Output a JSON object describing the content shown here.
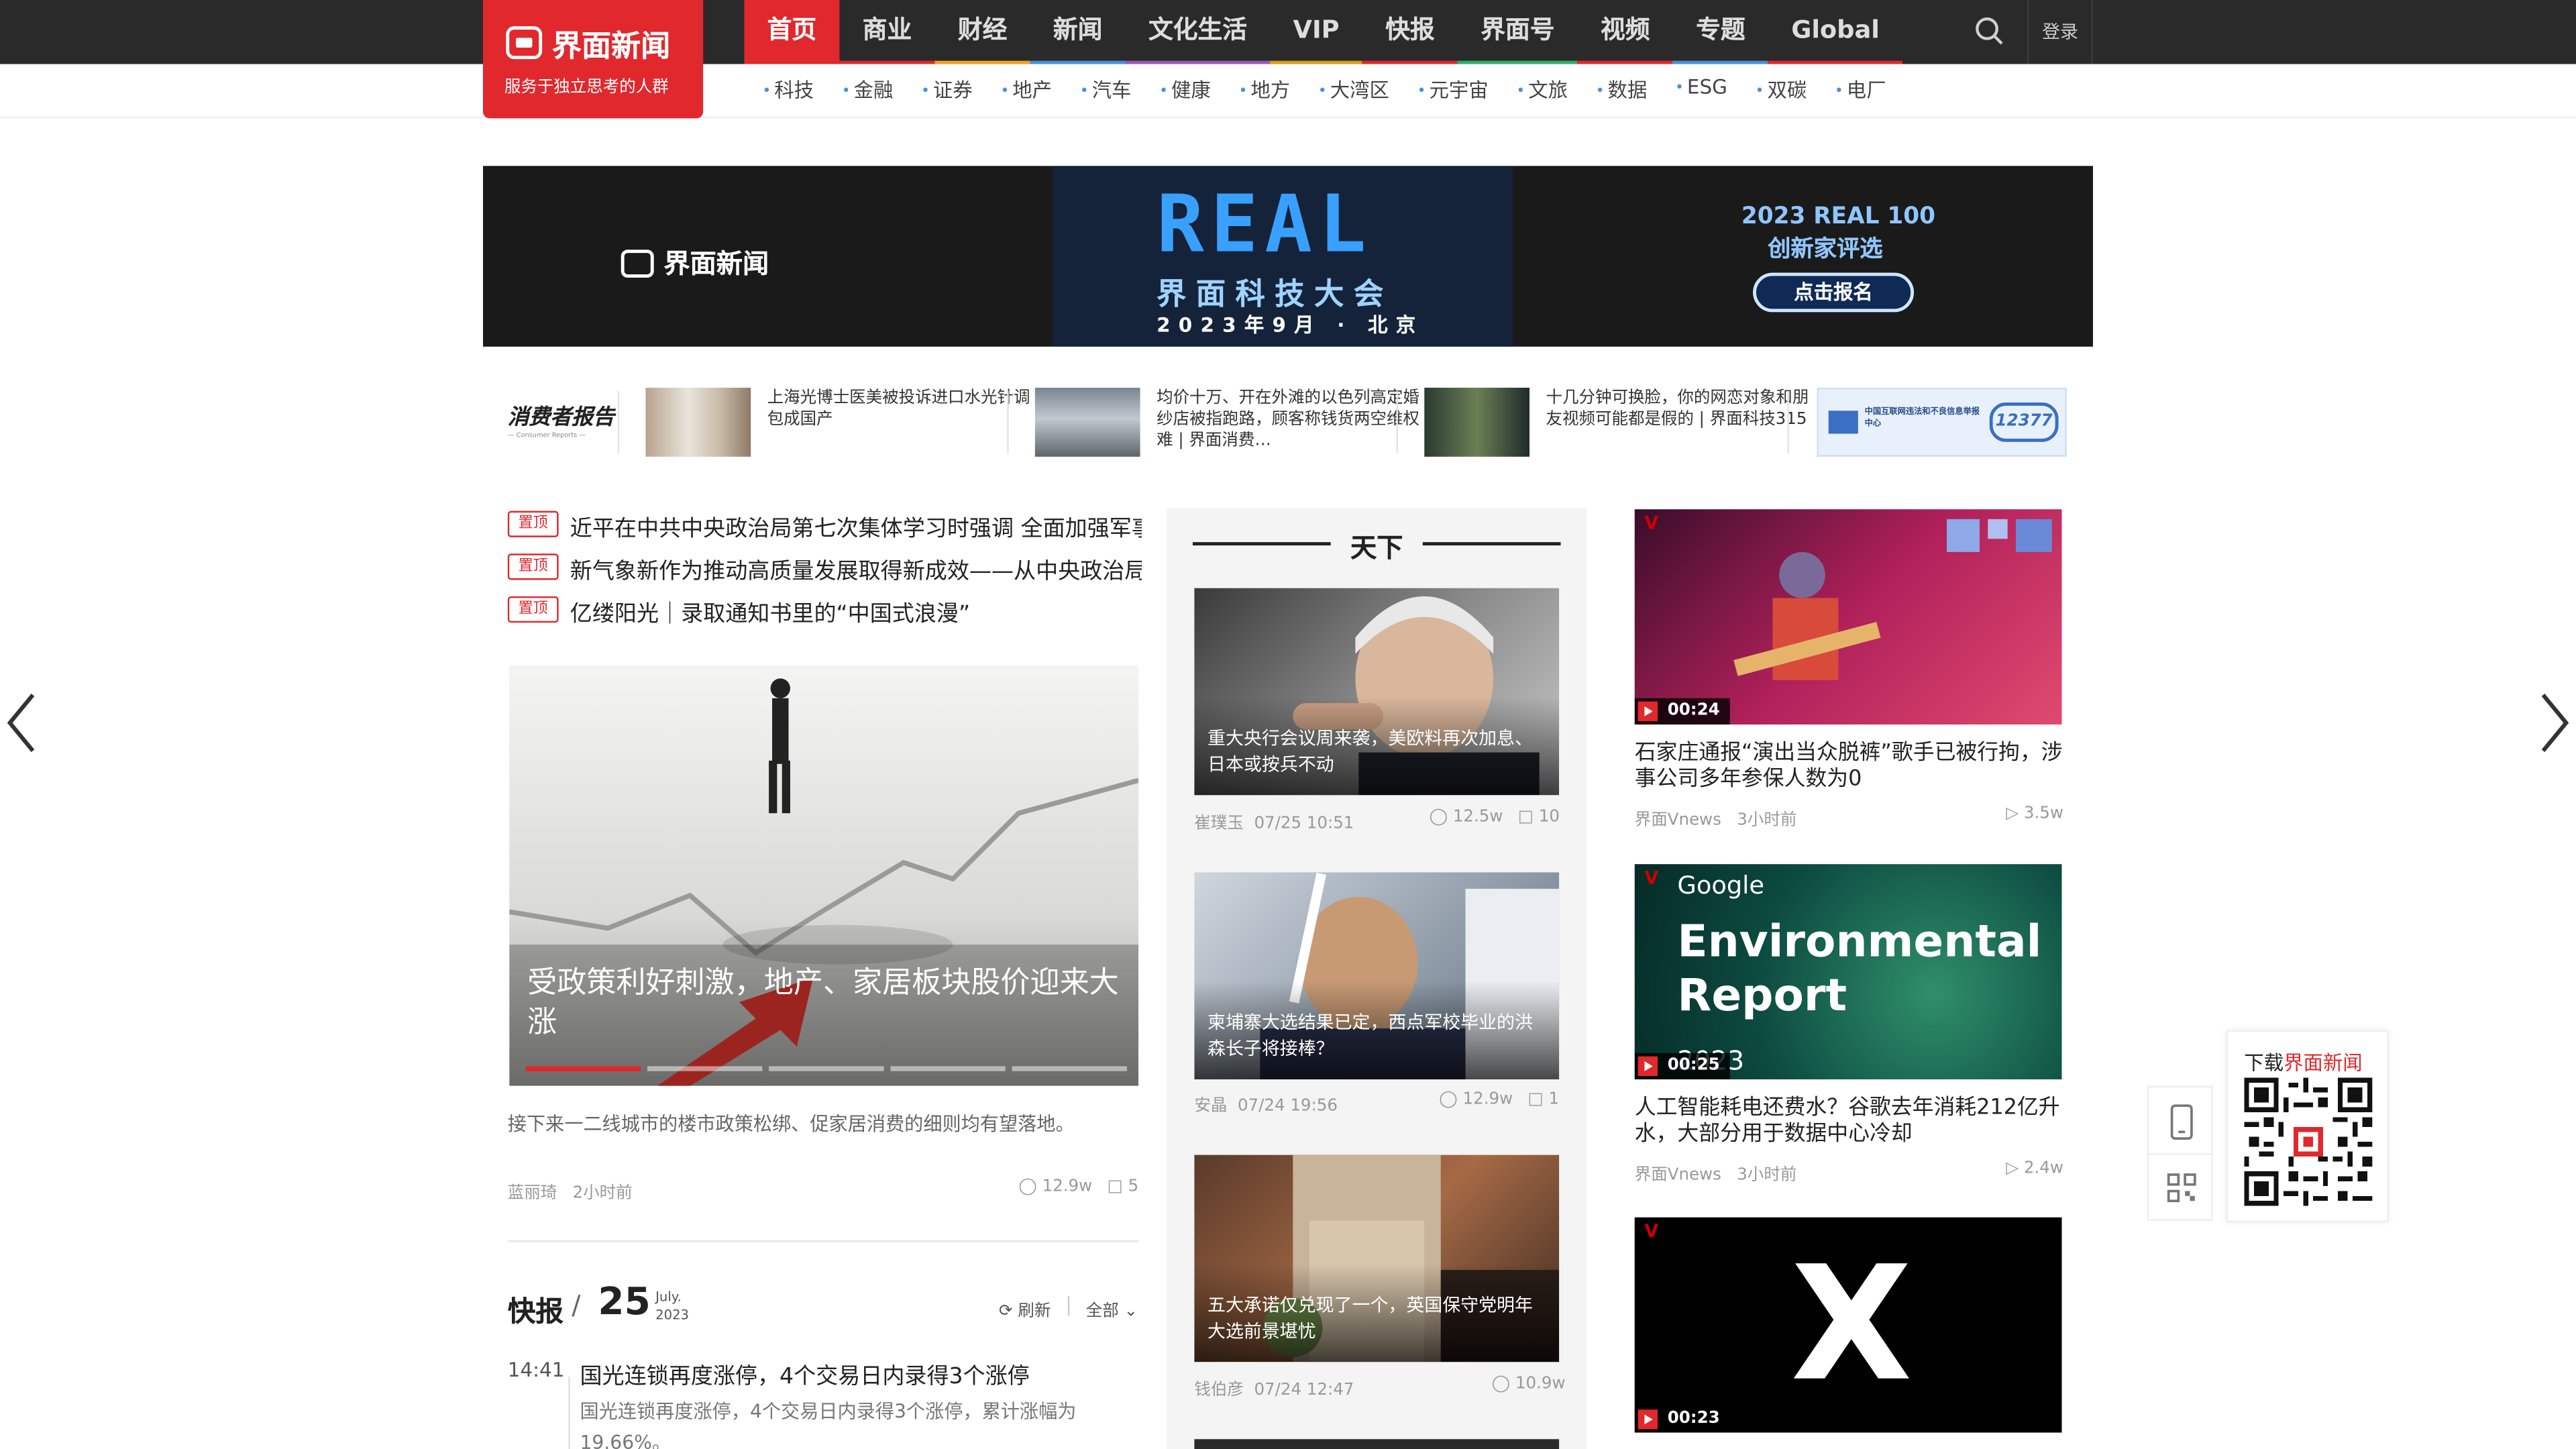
{
  "brand": {
    "name": "界面新闻",
    "slogan": "服务于独立思考的人群"
  },
  "nav": {
    "items": [
      {
        "label": "首页",
        "accent": "#e0282d"
      },
      {
        "label": "商业",
        "accent": "#e0282d"
      },
      {
        "label": "财经",
        "accent": "#f0a020"
      },
      {
        "label": "新闻",
        "accent": "#4a90d9"
      },
      {
        "label": "文化生活",
        "accent": "#9b59b6"
      },
      {
        "label": "VIP",
        "accent": "#d4a017"
      },
      {
        "label": "快报",
        "accent": "#e0282d"
      },
      {
        "label": "界面号",
        "accent": "#2eaf6a"
      },
      {
        "label": "视频",
        "accent": "#e0282d"
      },
      {
        "label": "专题",
        "accent": "#4a90d9"
      },
      {
        "label": "Global",
        "accent": "#e0282d"
      }
    ],
    "login": "登录"
  },
  "subnav": [
    "科技",
    "金融",
    "证券",
    "地产",
    "汽车",
    "健康",
    "地方",
    "大湾区",
    "元宇宙",
    "文旅",
    "数据",
    "ESG",
    "双碳",
    "电厂"
  ],
  "banner": {
    "logo": "界面新闻",
    "headline": "REAL",
    "conference": "界面科技大会",
    "date": "2023年9月 · 北京",
    "right_line1": "2023 REAL 100",
    "right_line2": "创新家评选",
    "button": "点击报名"
  },
  "promo": {
    "label": "消费者报告",
    "label_sub": "— Consumer Reports —",
    "items": [
      "上海光博士医美被投诉进口水光针调包成国产",
      "均价十万、开在外滩的以色列高定婚纱店被指跑路，顾客称钱货两空维权难 | 界面消费…",
      "十几分钟可换脸，你的网恋对象和朋友视频可能都是假的 | 界面科技315"
    ],
    "ad_left": "中国互联网违法和不良信息举报中心",
    "ad_right": "12377"
  },
  "pinned": {
    "badge": "置顶",
    "items": [
      "近平在中共中央政治局第七次集体学习时强调 全面加强军事治",
      "新气象新作为推动高质量发展取得新成效——从中央政治局会",
      "亿缕阳光｜录取通知书里的“中国式浪漫”"
    ]
  },
  "hero": {
    "caption": "受政策利好刺激，地产、家居板块股价迎来大涨",
    "desc": "接下来一二线城市的楼市政策松绑、促家居消费的细则均有望落地。",
    "author": "蓝丽琦",
    "time": "2小时前",
    "views": "12.9w",
    "comments": "5"
  },
  "flash": {
    "title": "快报",
    "day": "25",
    "month": "July.",
    "year": "2023",
    "refresh": "刷新",
    "filter": "全部",
    "item_time": "14:41",
    "item_head": "国光连锁再度涨停，4个交易日内录得3个涨停",
    "item_body": "国光连锁再度涨停，4个交易日内录得3个涨停，累计涨幅为19.66%。"
  },
  "world": {
    "title": "天下",
    "items": [
      {
        "caption": "重大央行会议周来袭，美欧料再次加息、日本或按兵不动",
        "author": "崔璞玉",
        "time": "07/25 10:51",
        "views": "12.5w",
        "comments": "10"
      },
      {
        "caption": "柬埔寨大选结果已定，西点军校毕业的洪森长子将接棒？",
        "author": "安晶",
        "time": "07/24 19:56",
        "views": "12.9w",
        "comments": "1"
      },
      {
        "caption": "五大承诺仅兑现了一个，英国保守党明年大选前景堪忧",
        "author": "钱伯彦",
        "time": "07/24 12:47",
        "views": "10.9w",
        "comments": ""
      }
    ]
  },
  "videos": {
    "items": [
      {
        "duration": "00:24",
        "title": "石家庄通报“演出当众脱裤”歌手已被行拘，涉事公司多年参保人数为0",
        "source": "界面Vnews",
        "time": "3小时前",
        "views": "3.5w"
      },
      {
        "duration": "00:25",
        "title": "人工智能耗电还费水？谷歌去年消耗212亿升水，大部分用于数据中心冷却",
        "source": "界面Vnews",
        "time": "3小时前",
        "views": "2.4w",
        "poster_line1": "Google",
        "poster_line2": "Environmental",
        "poster_line3": "Report",
        "poster_year": "2023"
      },
      {
        "duration": "00:23",
        "poster_mark": "X"
      }
    ]
  },
  "download": {
    "label_prefix": "下载",
    "label_brand": "界面新闻"
  },
  "colors": {
    "brand_red": "#e0282d",
    "topbar": "#2a2a2a",
    "link_blue": "#4a90d9"
  }
}
